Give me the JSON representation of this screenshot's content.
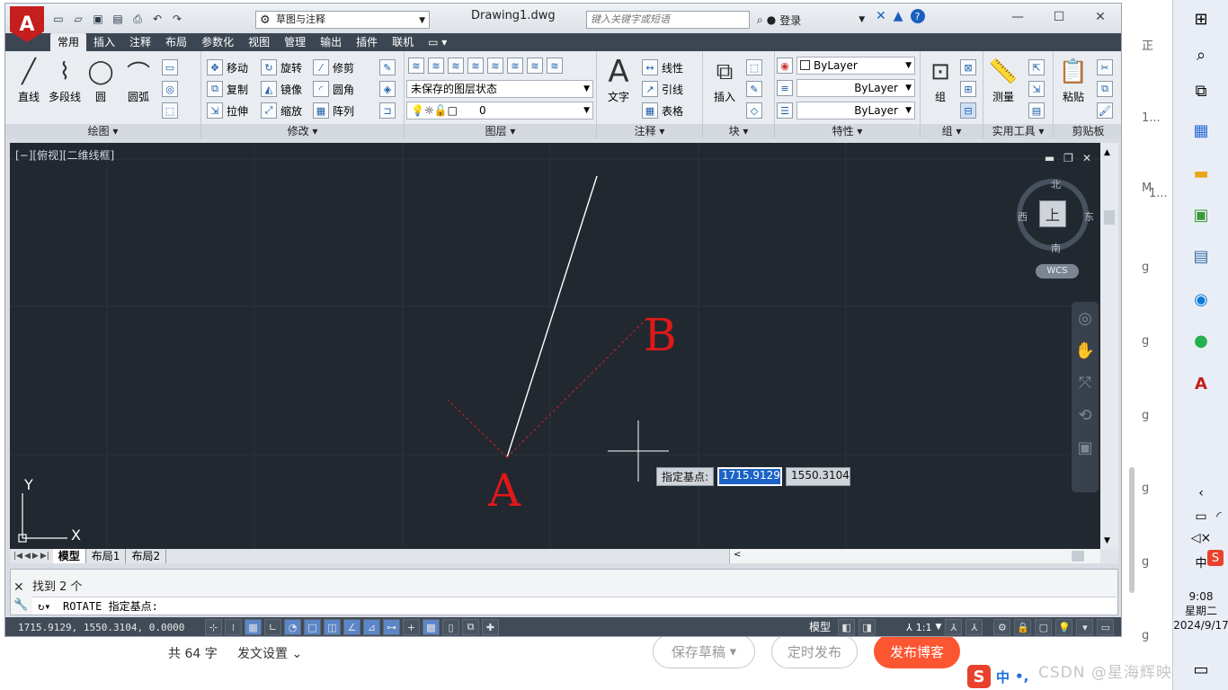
{
  "background_page": {
    "right_strip_fragments": [
      "正",
      "1...",
      "M",
      "1...",
      "g",
      "g",
      "g",
      "g",
      "g",
      "ng",
      "g"
    ],
    "word_count": "共 64 字",
    "post_settings": "发文设置",
    "btn_save_draft": "保存草稿",
    "btn_schedule": "定时发布",
    "btn_publish": "发布博客",
    "watermark": "CSDN @星海辉映",
    "ime_zh": "中",
    "ime_dot": "•,"
  },
  "window": {
    "doc_title": "Drawing1.dwg",
    "workspace": "草图与注释",
    "help_search_placeholder": "键入关键字或短语",
    "login": "登录"
  },
  "ribbon_tabs": [
    "常用",
    "插入",
    "注释",
    "布局",
    "参数化",
    "视图",
    "管理",
    "输出",
    "插件",
    "联机"
  ],
  "panels": {
    "draw": {
      "title": "绘图",
      "line": "直线",
      "polyline": "多段线",
      "circle": "圆",
      "arc": "圆弧"
    },
    "modify": {
      "title": "修改",
      "move": "移动",
      "rotate": "旋转",
      "trim": "修剪",
      "copy": "复制",
      "mirror": "镜像",
      "fillet": "圆角",
      "stretch": "拉伸",
      "scale": "缩放",
      "array": "阵列"
    },
    "layers": {
      "title": "图层",
      "layer_state": "未保存的图层状态",
      "current_layer": "0"
    },
    "annotation": {
      "title": "注释",
      "text": "文字",
      "linear": "线性",
      "leader": "引线",
      "table": "表格"
    },
    "block": {
      "title": "块",
      "insert": "插入"
    },
    "properties": {
      "title": "特性",
      "color": "ByLayer",
      "linetype": "ByLayer",
      "lineweight": "ByLayer"
    },
    "group": {
      "title": "组",
      "group": "组"
    },
    "utilities": {
      "title": "实用工具",
      "measure": "测量"
    },
    "clipboard": {
      "title": "剪贴板",
      "paste": "粘贴"
    }
  },
  "viewport": {
    "label": "[−][俯视][二维线框]",
    "viewcube": {
      "north": "北",
      "south": "南",
      "east": "东",
      "west": "西",
      "top": "上",
      "wcs": "WCS"
    },
    "ucs_x": "X",
    "ucs_y": "Y",
    "point_a": "A",
    "point_b": "B",
    "dyn_prompt": "指定基点:",
    "dyn_x": "1715.9129",
    "dyn_y": "1550.3104"
  },
  "layout_tabs": [
    "模型",
    "布局1",
    "布局2"
  ],
  "command": {
    "history": "找到 2 个",
    "current": "ROTATE 指定基点:"
  },
  "status": {
    "coords": "1715.9129,  1550.3104,  0.0000",
    "model": "模型",
    "scale": "1:1"
  },
  "taskbar": {
    "time": "9:08",
    "weekday": "星期二",
    "date": "2024/9/17",
    "ime_zh": "中"
  }
}
